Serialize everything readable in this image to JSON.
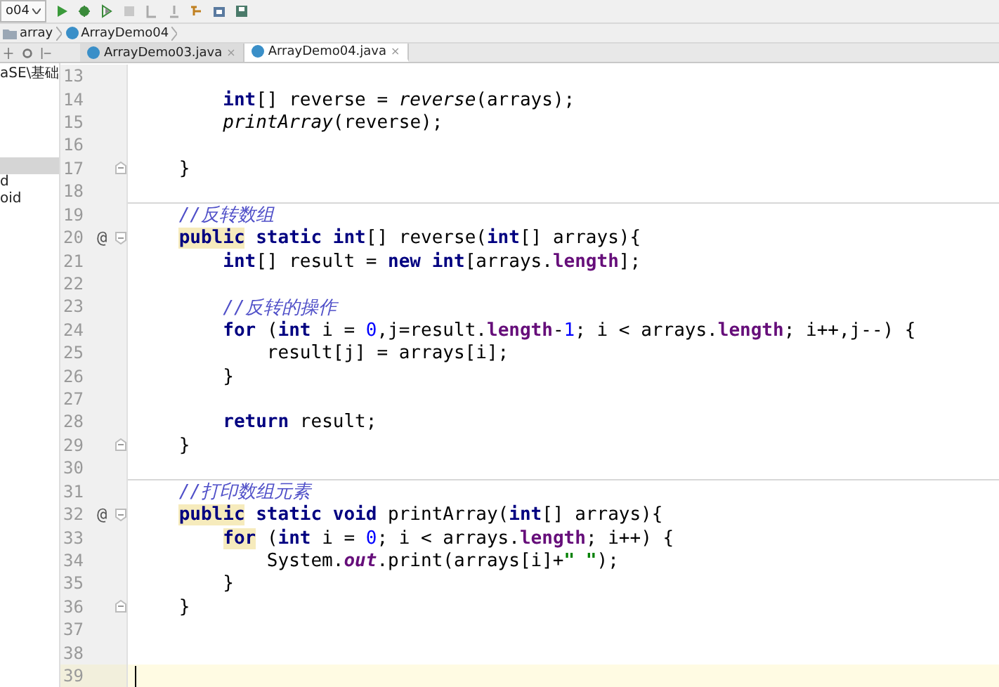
{
  "toolbar": {
    "run_config": "o04"
  },
  "breadcrumbs": [
    {
      "label": "array",
      "kind": "folder"
    },
    {
      "label": "ArrayDemo04",
      "kind": "class"
    }
  ],
  "tabs": [
    {
      "label": "ArrayDemo03.java",
      "close": "×",
      "selected": false
    },
    {
      "label": "ArrayDemo04.java",
      "close": "×",
      "selected": true
    }
  ],
  "project_tree": [
    {
      "label": "aSE\\基础",
      "selected": false
    },
    {
      "selected": true
    },
    {
      "label": "d",
      "selected": false
    },
    {
      "label": "oid",
      "selected": false
    }
  ],
  "editor": {
    "lines": [
      {
        "number": "13"
      },
      {
        "number": "14",
        "tokens": [
          {
            "t": "        int",
            "kind": "kw"
          },
          {
            "t": "[] reverse = ",
            "kind": "plain"
          },
          {
            "t": "reverse",
            "kind": "call"
          },
          {
            "t": "(arrays);",
            "kind": "plain"
          }
        ]
      },
      {
        "number": "15",
        "tokens": [
          {
            "t": "        printArray",
            "kind": "call"
          },
          {
            "t": "(reverse);",
            "kind": "plain"
          }
        ]
      },
      {
        "number": "16"
      },
      {
        "number": "17",
        "fold": {
          "kind": "end"
        },
        "tokens": [
          {
            "t": "    }",
            "kind": "plain"
          }
        ]
      },
      {
        "number": "18"
      },
      {
        "number": "19",
        "separator": true,
        "tokens": [
          {
            "t": "    //反转数组",
            "kind": "comment"
          }
        ]
      },
      {
        "number": "20",
        "mark": "@",
        "fold": {
          "kind": "start"
        },
        "tokens": [
          {
            "t": "    public",
            "kind": "kw",
            "hl": true
          },
          {
            "t": " static int",
            "kind": "kw"
          },
          {
            "t": "[] reverse(",
            "kind": "plain"
          },
          {
            "t": "int",
            "kind": "kw"
          },
          {
            "t": "[] arrays){",
            "kind": "plain"
          }
        ]
      },
      {
        "number": "21",
        "tokens": [
          {
            "t": "        int",
            "kind": "kw"
          },
          {
            "t": "[] result = ",
            "kind": "plain"
          },
          {
            "t": "new int",
            "kind": "kw"
          },
          {
            "t": "[arrays.",
            "kind": "plain"
          },
          {
            "t": "length",
            "kind": "field"
          },
          {
            "t": "];",
            "kind": "plain"
          }
        ]
      },
      {
        "number": "22"
      },
      {
        "number": "23",
        "tokens": [
          {
            "t": "        //反转的操作",
            "kind": "comment"
          }
        ]
      },
      {
        "number": "24",
        "tokens": [
          {
            "t": "        for",
            "kind": "kw"
          },
          {
            "t": " (",
            "kind": "plain"
          },
          {
            "t": "int",
            "kind": "kw"
          },
          {
            "t": " i = ",
            "kind": "plain"
          },
          {
            "t": "0",
            "kind": "num"
          },
          {
            "t": ",j=result.",
            "kind": "plain"
          },
          {
            "t": "length",
            "kind": "field"
          },
          {
            "t": "-",
            "kind": "plain"
          },
          {
            "t": "1",
            "kind": "num"
          },
          {
            "t": "; i < arrays.",
            "kind": "plain"
          },
          {
            "t": "length",
            "kind": "field"
          },
          {
            "t": "; i++,j--) {",
            "kind": "plain"
          }
        ]
      },
      {
        "number": "25",
        "tokens": [
          {
            "t": "            result[j] = arrays[i];",
            "kind": "plain"
          }
        ]
      },
      {
        "number": "26",
        "tokens": [
          {
            "t": "        }",
            "kind": "plain"
          }
        ]
      },
      {
        "number": "27"
      },
      {
        "number": "28",
        "tokens": [
          {
            "t": "        return",
            "kind": "kw"
          },
          {
            "t": " result;",
            "kind": "plain"
          }
        ]
      },
      {
        "number": "29",
        "fold": {
          "kind": "end"
        },
        "tokens": [
          {
            "t": "    }",
            "kind": "plain"
          }
        ]
      },
      {
        "number": "30"
      },
      {
        "number": "31",
        "separator": true,
        "tokens": [
          {
            "t": "    //打印数组元素",
            "kind": "comment"
          }
        ]
      },
      {
        "number": "32",
        "mark": "@",
        "fold": {
          "kind": "start"
        },
        "tokens": [
          {
            "t": "    public",
            "kind": "kw",
            "hl": true
          },
          {
            "t": " static void",
            "kind": "kw"
          },
          {
            "t": " printArray(",
            "kind": "plain"
          },
          {
            "t": "int",
            "kind": "kw"
          },
          {
            "t": "[] arrays){",
            "kind": "plain"
          }
        ]
      },
      {
        "number": "33",
        "tokens": [
          {
            "t": "        for",
            "kind": "kw",
            "hl": true
          },
          {
            "t": " (",
            "kind": "plain"
          },
          {
            "t": "int",
            "kind": "kw"
          },
          {
            "t": " i = ",
            "kind": "plain"
          },
          {
            "t": "0",
            "kind": "num"
          },
          {
            "t": "; i < arrays.",
            "kind": "plain"
          },
          {
            "t": "length",
            "kind": "field"
          },
          {
            "t": "; i++) {",
            "kind": "plain"
          }
        ]
      },
      {
        "number": "34",
        "tokens": [
          {
            "t": "            System.",
            "kind": "plain"
          },
          {
            "t": "out",
            "kind": "static_field"
          },
          {
            "t": ".print(arrays[i]+",
            "kind": "plain"
          },
          {
            "t": "\" \"",
            "kind": "string"
          },
          {
            "t": ");",
            "kind": "plain"
          }
        ]
      },
      {
        "number": "35",
        "tokens": [
          {
            "t": "        }",
            "kind": "plain"
          }
        ]
      },
      {
        "number": "36",
        "fold": {
          "kind": "end"
        },
        "tokens": [
          {
            "t": "    }",
            "kind": "plain"
          }
        ]
      },
      {
        "number": "37"
      },
      {
        "number": "38"
      },
      {
        "number": "39",
        "current": true
      }
    ]
  }
}
